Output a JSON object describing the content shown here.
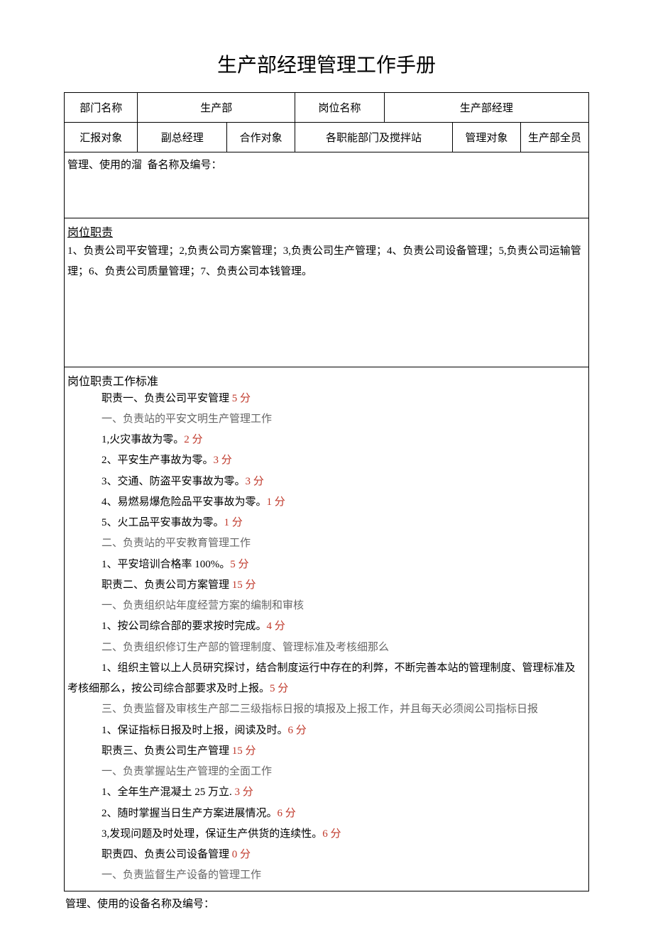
{
  "title": "生产部经理管理工作手册",
  "header": {
    "dept_label": "部门名称",
    "dept_value": "生产部",
    "post_label": "岗位名称",
    "post_value": "生产部经理",
    "report_label": "汇报对象",
    "report_value": "副总经理",
    "coop_label": "合作对象",
    "coop_value": "各职能部门及搅拌站",
    "manage_label": "管理对象",
    "manage_value": "生产部全员",
    "equip_label": "管理、使用的溜",
    "equip_suffix": "备名称及编号："
  },
  "duties": {
    "title": "岗位职责",
    "text": "1、负责公司平安管理；2,负责公司方案管理；3,负责公司生产管理；4、负责公司设备管理；5,负责公司运输管理；6、负责公司质量管理；7、负责公司本钱管理。"
  },
  "standards": {
    "title": "岗位职责工作标准",
    "z1": {
      "head_pre": "职责一、负责公司平安管理 ",
      "points": "5 分",
      "sub1": "一、负责站的平安文明生产管理工作",
      "i1_pre": "1,火灾事故为零。",
      "i1_pts": "2 分",
      "i2_pre": "2、平安生产事故为零。",
      "i2_pts": "3 分",
      "i3_pre": "3、交通、防盗平安事故为零。",
      "i3_pts": "3 分",
      "i4_pre": "4、易燃易爆危险品平安事故为零。",
      "i4_pts": "1 分",
      "i5_pre": "5、火工品平安事故为零。",
      "i5_pts": "1 分",
      "sub2": "二、负责站的平安教育管理工作",
      "i6_pre": "1、平安培训合格率 100%。",
      "i6_pts": "5 分"
    },
    "z2": {
      "head_pre": "职责二、负责公司方案管理 ",
      "points": "15 分",
      "sub1": "一、负责组织站年度经营方案的编制和审核",
      "i1_pre": "1、按公司综合部的要求按时完成。",
      "i1_pts": "4 分",
      "sub2": "二、负责组织修订生产部的管理制度、管理标准及考核细那么",
      "i2_pre": "1、组织主管以上人员研究探讨，结合制度运行中存在的利弊，不断完善本站的管理制度、管理标准及考核细那么，按公司综合部要求及时上报。",
      "i2_pts": "5 分",
      "sub3": "三、负责监督及审核生产部二三级指标日报的填报及上报工作，并且每天必须阅公司指标日报",
      "i3_pre": "1、保证指标日报及时上报，阅读及时。",
      "i3_pts": "6 分"
    },
    "z3": {
      "head_pre": "职责三、负责公司生产管理 ",
      "points": "15 分",
      "sub1": "一、负责掌握站生产管理的全面工作",
      "i1_pre": "1、全年生产混凝土 25 万立. ",
      "i1_pts": "3 分",
      "i2_pre": "2、随时掌握当日生产方案进展情况。",
      "i2_pts": "6 分",
      "i3_pre": "3,发现问题及时处理，保证生产供货的连续性。",
      "i3_pts": "6 分"
    },
    "z4": {
      "head_pre": "职责四、负责公司设备管理 ",
      "points": "0 分",
      "sub1": "一、负责监督生产设备的管理工作"
    }
  },
  "footer_note": "管理、使用的设备名称及编号："
}
